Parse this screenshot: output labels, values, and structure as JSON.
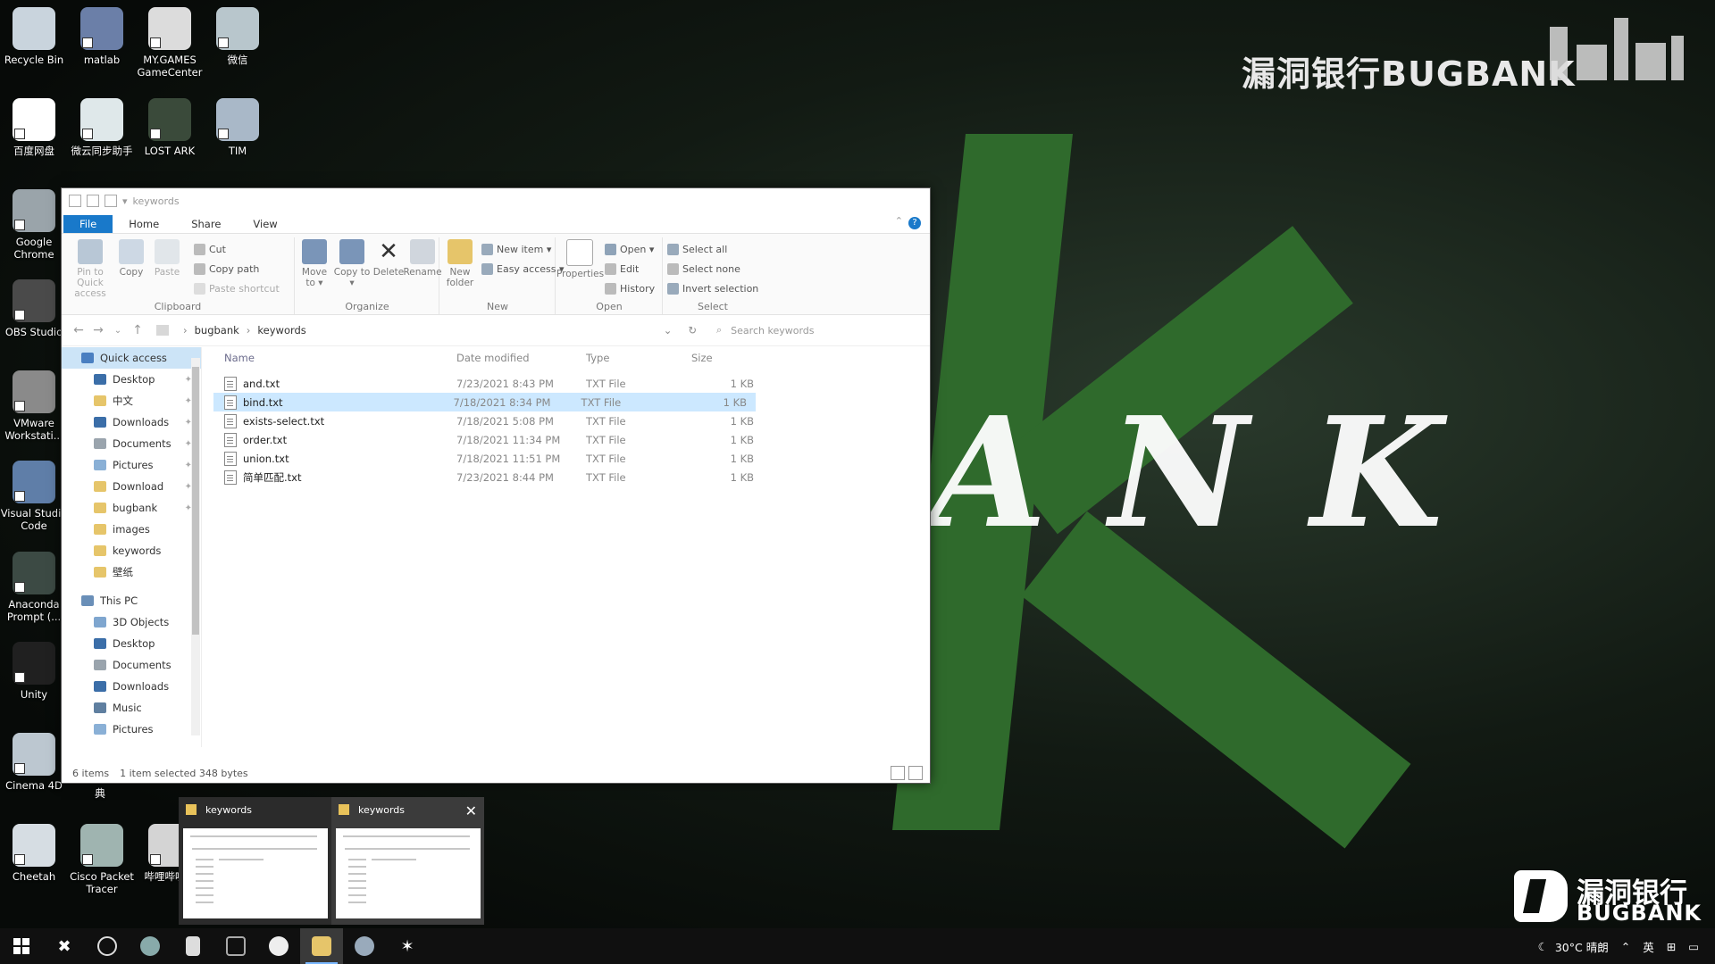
{
  "desktop": {
    "icons": [
      {
        "label": "Recycle Bin",
        "icon": "recycle-bin-icon",
        "color": "#c9d4dd"
      },
      {
        "label": "matlab",
        "icon": "matlab-icon",
        "color": "#6b7fa8"
      },
      {
        "label": "MY.GAMES GameCenter",
        "icon": "gamecenter-icon",
        "color": "#dcdcdc"
      },
      {
        "label": "微信",
        "icon": "wechat-icon",
        "color": "#b8c6cc"
      },
      {
        "label": "百度网盘",
        "icon": "baidu-netdisk-icon",
        "color": "#ffffff"
      },
      {
        "label": "微云同步助手",
        "icon": "weiyun-icon",
        "color": "#dfe8ea"
      },
      {
        "label": "LOST ARK",
        "icon": "lost-ark-icon",
        "color": "#3a4a3a"
      },
      {
        "label": "TIM",
        "icon": "tim-icon",
        "color": "#a9b8c8"
      },
      {
        "label": "Google Chrome",
        "icon": "chrome-icon",
        "color": "#9aa4aa"
      },
      {
        "label": "OBS Studio",
        "icon": "obs-icon",
        "color": "#4a4a4a"
      },
      {
        "label": "VMware Workstati...",
        "icon": "vmware-icon",
        "color": "#8a8a8a"
      },
      {
        "label": "Visual Studio Code",
        "icon": "vscode-icon",
        "color": "#5f7ea8"
      },
      {
        "label": "Anaconda Prompt (...",
        "icon": "anaconda-icon",
        "color": "#3c4a44"
      },
      {
        "label": "Unity",
        "icon": "unity-icon",
        "color": "#202020"
      },
      {
        "label": "Cinema 4D",
        "icon": "cinema4d-icon",
        "color": "#bcc7d0"
      },
      {
        "label": "Cheetah",
        "icon": "cheetah-icon",
        "color": "#d6dde3"
      },
      {
        "label": "Cisco Packet Tracer",
        "icon": "cisco-packet-tracer-icon",
        "color": "#9fb4b0"
      },
      {
        "label": "哔哩哔哩...",
        "icon": "bilibili-live-icon",
        "color": "#d4d4d4"
      }
    ],
    "partial_label": "典"
  },
  "wallpaper": {
    "brand_top": "漏洞银行BUGBANK",
    "big_word": "ANK",
    "brand_bottom_cn": "漏洞银行",
    "brand_bottom_en": "BUGBANK",
    "accent_green": "#2f6a2c"
  },
  "explorer": {
    "title": "keywords",
    "tabs": [
      "File",
      "Home",
      "Share",
      "View"
    ],
    "ribbon": {
      "clipboard": {
        "label": "Clipboard",
        "pin": "Pin to Quick access",
        "copy": "Copy",
        "paste": "Paste",
        "cut": "Cut",
        "copy_path": "Copy path",
        "paste_shortcut": "Paste shortcut"
      },
      "organize": {
        "label": "Organize",
        "move_to": "Move to ▾",
        "copy_to": "Copy to ▾",
        "delete": "Delete",
        "rename": "Rename"
      },
      "new": {
        "label": "New",
        "new_folder": "New folder",
        "new_item": "New item ▾",
        "easy_access": "Easy access ▾"
      },
      "open": {
        "label": "Open",
        "properties": "Properties",
        "open": "Open ▾",
        "edit": "Edit",
        "history": "History"
      },
      "select": {
        "label": "Select",
        "select_all": "Select all",
        "select_none": "Select none",
        "invert_selection": "Invert selection"
      }
    },
    "address": {
      "path": [
        "bugbank",
        "keywords"
      ],
      "search_placeholder": "Search keywords"
    },
    "nav": {
      "quick_access": "Quick access",
      "quick_items": [
        {
          "label": "Desktop",
          "pinned": true
        },
        {
          "label": "中文",
          "pinned": true
        },
        {
          "label": "Downloads",
          "pinned": true
        },
        {
          "label": "Documents",
          "pinned": true
        },
        {
          "label": "Pictures",
          "pinned": true
        },
        {
          "label": "Download",
          "pinned": true
        },
        {
          "label": "bugbank",
          "pinned": true
        },
        {
          "label": "images",
          "pinned": false
        },
        {
          "label": "keywords",
          "pinned": false
        },
        {
          "label": "壁纸",
          "pinned": false
        }
      ],
      "this_pc": "This PC",
      "pc_items": [
        "3D Objects",
        "Desktop",
        "Documents",
        "Downloads",
        "Music",
        "Pictures"
      ]
    },
    "columns": {
      "name": "Name",
      "date": "Date modified",
      "type": "Type",
      "size": "Size"
    },
    "files": [
      {
        "name": "and.txt",
        "date": "7/23/2021 8:43 PM",
        "type": "TXT File",
        "size": "1 KB",
        "selected": false
      },
      {
        "name": "bind.txt",
        "date": "7/18/2021 8:34 PM",
        "type": "TXT File",
        "size": "1 KB",
        "selected": true
      },
      {
        "name": "exists-select.txt",
        "date": "7/18/2021 5:08 PM",
        "type": "TXT File",
        "size": "1 KB",
        "selected": false
      },
      {
        "name": "order.txt",
        "date": "7/18/2021 11:34 PM",
        "type": "TXT File",
        "size": "1 KB",
        "selected": false
      },
      {
        "name": "union.txt",
        "date": "7/18/2021 11:51 PM",
        "type": "TXT File",
        "size": "1 KB",
        "selected": false
      },
      {
        "name": "简单匹配.txt",
        "date": "7/23/2021 8:44 PM",
        "type": "TXT File",
        "size": "1 KB",
        "selected": false
      }
    ],
    "status": {
      "items": "6 items",
      "selection": "1 item selected  348 bytes"
    }
  },
  "thumbnails": [
    {
      "title": "keywords",
      "active": false
    },
    {
      "title": "keywords",
      "active": true
    }
  ],
  "taskbar": {
    "tray": {
      "weather": "30°C 晴朗",
      "ime": "英"
    }
  }
}
